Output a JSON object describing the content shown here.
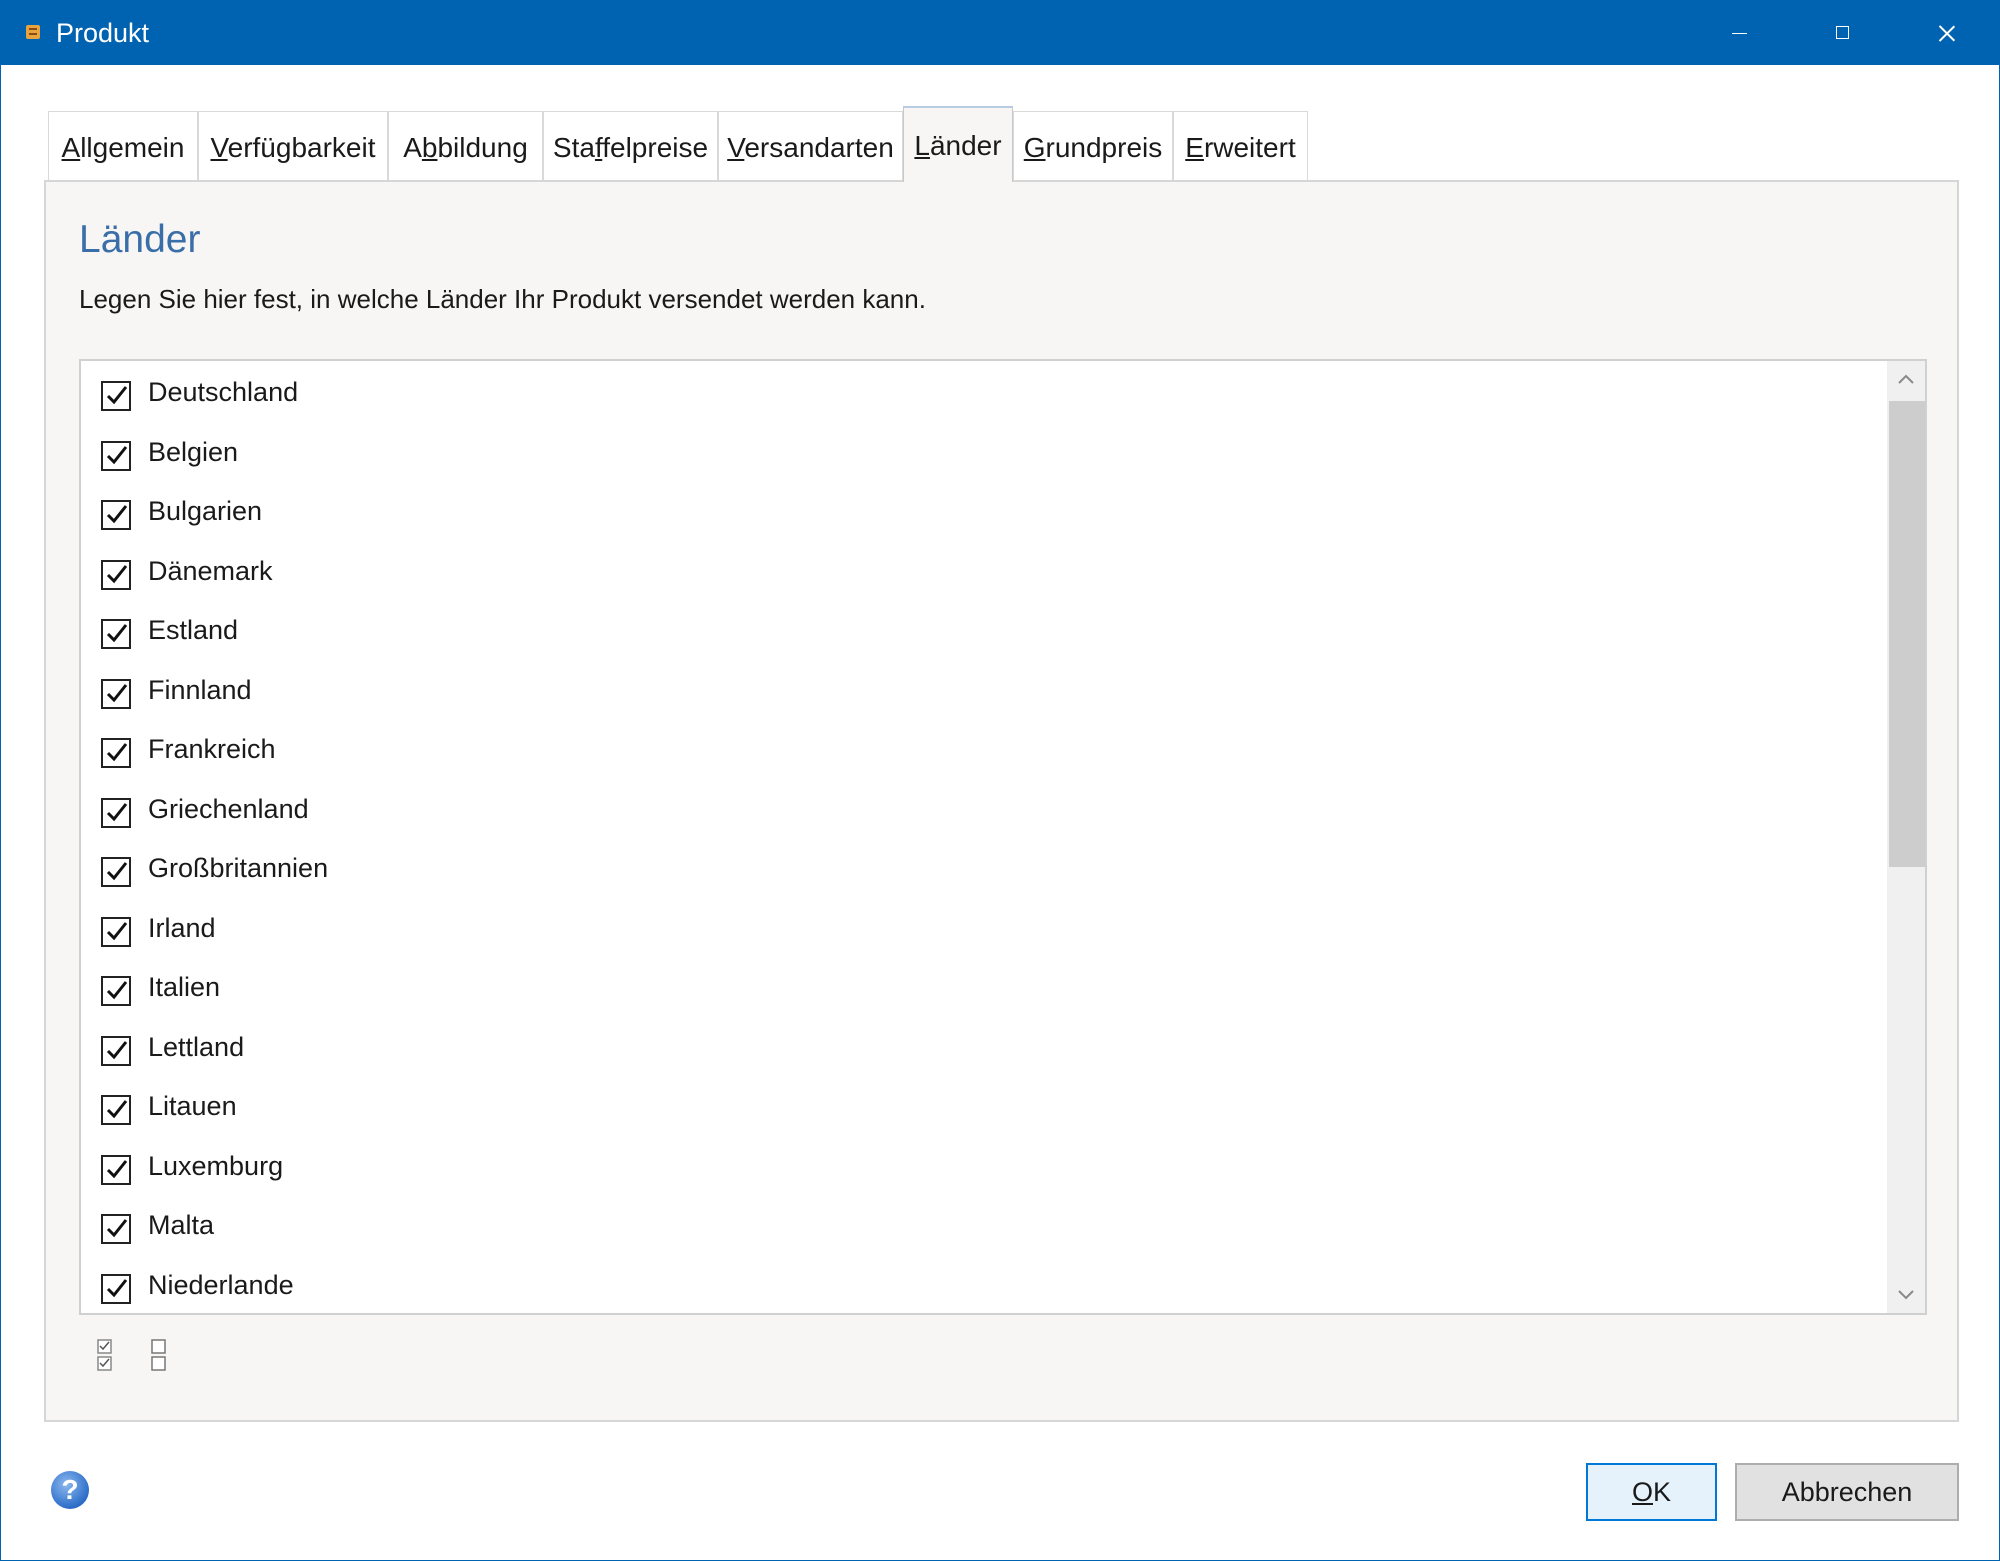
{
  "window": {
    "title": "Produkt"
  },
  "tabs": [
    {
      "label": "Allgemein",
      "mnemonic": "A",
      "rest": "llgemein"
    },
    {
      "label": "Verfügbarkeit",
      "mnemonic": "V",
      "rest": "erfügbarkeit"
    },
    {
      "label": "Abbildung",
      "pre": "A",
      "mnemonic": "b",
      "rest": "bildung"
    },
    {
      "label": "Staffelpreise",
      "pre": "Sta",
      "mnemonic": "f",
      "rest": "felpreise"
    },
    {
      "label": "Versandarten",
      "mnemonic": "V",
      "rest": "ersandarten"
    },
    {
      "label": "Länder",
      "mnemonic": "L",
      "rest": "änder",
      "active": true
    },
    {
      "label": "Grundpreis",
      "mnemonic": "G",
      "rest": "rundpreis"
    },
    {
      "label": "Erweitert",
      "mnemonic": "E",
      "rest": "rweitert"
    }
  ],
  "panel": {
    "title": "Länder",
    "description": "Legen Sie hier fest, in welche Länder Ihr Produkt versendet werden kann."
  },
  "countries": [
    {
      "name": "Deutschland",
      "checked": true
    },
    {
      "name": "Belgien",
      "checked": true
    },
    {
      "name": "Bulgarien",
      "checked": true
    },
    {
      "name": "Dänemark",
      "checked": true
    },
    {
      "name": "Estland",
      "checked": true
    },
    {
      "name": "Finnland",
      "checked": true
    },
    {
      "name": "Frankreich",
      "checked": true
    },
    {
      "name": "Griechenland",
      "checked": true
    },
    {
      "name": "Großbritannien",
      "checked": true
    },
    {
      "name": "Irland",
      "checked": true
    },
    {
      "name": "Italien",
      "checked": true
    },
    {
      "name": "Lettland",
      "checked": true
    },
    {
      "name": "Litauen",
      "checked": true
    },
    {
      "name": "Luxemburg",
      "checked": true
    },
    {
      "name": "Malta",
      "checked": true
    },
    {
      "name": "Niederlande",
      "checked": true
    }
  ],
  "buttons": {
    "ok": {
      "mnemonic": "O",
      "rest": "K"
    },
    "cancel": "Abbrechen",
    "help_glyph": "?"
  },
  "icons": {
    "check_all": "check-all-icon",
    "uncheck_all": "uncheck-all-icon",
    "help": "help-icon"
  },
  "colors": {
    "titlebar": "#0063b1",
    "panel_title": "#3a6ea8",
    "ok_border": "#0078d7"
  }
}
